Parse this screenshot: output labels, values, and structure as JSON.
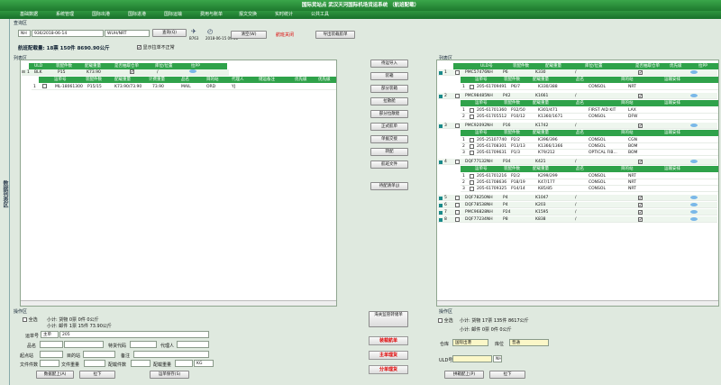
{
  "window": {
    "title": "国际货站点 武汉天河国际机场货运系统 （航班配载）"
  },
  "menu": [
    "基础数据",
    "系统管理",
    "国际出港",
    "国际进港",
    "国际运输",
    "费用与账单",
    "报文交换",
    "实时统计",
    "公共工具"
  ],
  "sidebar": {
    "label": "数据列表区"
  },
  "query": {
    "section_label": "查询区",
    "prefix": "NH",
    "flight_date": "936/2018-06-14",
    "route": "WUH/NRT",
    "query_btn": "查询(Q)",
    "plane_info": "B763",
    "time_info": "2018-06-15 09:40",
    "clear_btn": "清空(W)",
    "flight_status": "航班关闭",
    "export_btn": "导出装载航单",
    "summary": "航班配载量: 18票  150件  8690.90公斤",
    "show_unsigned_label": "显示拉单不正常"
  },
  "left_list": {
    "section_label": "列表区",
    "header": [
      "ULD",
      "装配件数",
      "配载重量",
      "是否抽取仓单",
      "库位/位置",
      "拉PP"
    ],
    "uld_row": {
      "idx": "1",
      "uld": "BLK",
      "pieces": "P15",
      "weight": "K73.90",
      "extracted": "✔",
      "location": "/"
    },
    "sub_header": [
      "运单号",
      "装配件数",
      "配载重量",
      "计费重量",
      "品名",
      "目的站",
      "代理人",
      "储运备注",
      "优先级",
      "优先级"
    ],
    "sub_row": {
      "idx": "1",
      "awb": "ML-18061300",
      "pieces": "P15/15",
      "weight": "K73.90/73.90",
      "charge": "73.90",
      "goods": "MAIL",
      "dest": "ORD",
      "agent": "YJ"
    }
  },
  "middle_buttons": [
    "待运导入",
    "装箱",
    "部分装箱",
    "拉散舱",
    "部分拉散舱",
    "正式航单",
    "单据交接",
    "转配",
    "航班文件",
    "待配清单(J)"
  ],
  "right_list": {
    "section_label": "列表区",
    "header": [
      "ULD号",
      "装配件数",
      "配载重量",
      "库位/位置",
      "是否抽取仓单",
      "优先级",
      "拉PP"
    ],
    "sub_header": [
      "运单号",
      "装配件数",
      "配载重量",
      "品名",
      "目的站",
      "运输安排"
    ],
    "groups": [
      {
        "idx": "1",
        "uld": "PMC57476NH",
        "pieces": "P6",
        "weight": "K330",
        "loc": "/",
        "extracted": "✔",
        "expanded": true,
        "subs": [
          {
            "idx": "1",
            "awb": "205-61709491",
            "pieces": "P6/7",
            "weight": "K330/388",
            "goods": "CONSOL",
            "dest": "NRT"
          }
        ]
      },
      {
        "idx": "2",
        "uld": "PMC98485NH",
        "pieces": "P42",
        "weight": "K1661",
        "loc": "/",
        "extracted": "✔",
        "expanded": true,
        "subs": [
          {
            "idx": "1",
            "awb": "205-61701360",
            "pieces": "P32/50",
            "weight": "K301/471",
            "goods": "FIRST AID KIT",
            "dest": "LAX"
          },
          {
            "idx": "2",
            "awb": "205-61705512",
            "pieces": "P10/12",
            "weight": "K1360/1671",
            "goods": "CONSOL",
            "dest": "DFW"
          }
        ]
      },
      {
        "idx": "3",
        "uld": "PMC92092NH",
        "pieces": "P16",
        "weight": "K1742",
        "loc": "/",
        "extracted": "✔",
        "expanded": true,
        "subs": [
          {
            "idx": "1",
            "awb": "205-25107740",
            "pieces": "P2/2",
            "weight": "K396/396",
            "goods": "CONSOL",
            "dest": "CGN"
          },
          {
            "idx": "2",
            "awb": "205-61708301",
            "pieces": "P13/13",
            "weight": "K1366/1366",
            "goods": "CONSOL",
            "dest": "BOM"
          },
          {
            "idx": "3",
            "awb": "205-61709631",
            "pieces": "P1/3",
            "weight": "K79/212",
            "goods": "OPTICAL FIB...",
            "dest": "BOM"
          }
        ]
      },
      {
        "idx": "4",
        "uld": "DQF77132NH",
        "pieces": "P34",
        "weight": "K421",
        "loc": "/",
        "extracted": "✔",
        "expanded": true,
        "subs": [
          {
            "idx": "1",
            "awb": "205-61701216",
            "pieces": "P2/2",
            "weight": "K299/299",
            "goods": "CONSOL",
            "dest": "NRT"
          },
          {
            "idx": "2",
            "awb": "205-61708636",
            "pieces": "P18/19",
            "weight": "K47/177",
            "goods": "CONSOL",
            "dest": "NRT"
          },
          {
            "idx": "3",
            "awb": "205-61709325",
            "pieces": "P14/14",
            "weight": "K85/85",
            "goods": "CONSOL",
            "dest": "NRT"
          }
        ]
      },
      {
        "idx": "5",
        "uld": "DQF78250NH",
        "pieces": "P4",
        "weight": "K1047",
        "loc": "/",
        "extracted": "✔",
        "expanded": false,
        "subs": []
      },
      {
        "idx": "6",
        "uld": "DQF78538NH",
        "pieces": "P4",
        "weight": "K203",
        "loc": "/",
        "extracted": "✔",
        "expanded": false,
        "subs": []
      },
      {
        "idx": "7",
        "uld": "PMC96828NH",
        "pieces": "P24",
        "weight": "K1595",
        "loc": "/",
        "extracted": "✔",
        "expanded": false,
        "subs": []
      },
      {
        "idx": "8",
        "uld": "DQF77234NH",
        "pieces": "P8",
        "weight": "K838",
        "loc": "/",
        "extracted": "✔",
        "expanded": false,
        "subs": []
      }
    ]
  },
  "left_op": {
    "section_label": "操作区",
    "select_all": "全选",
    "subtotal1": "小计: 货物  0票  0件  0公斤",
    "subtotal2": "小计: 邮件  1票  15件  73.90公斤",
    "awb_label": "运单号",
    "awb_prefix": "主单",
    "awb_value": "205",
    "goods_label": "品名",
    "special_label": "特货代码",
    "agent_label": "代理人",
    "origin_label": "起点站",
    "dest_label": "目的站",
    "remark_label": "备注",
    "files_label": "文件件数",
    "files_weight_label": "文件重量",
    "pieces_label": "配载件数",
    "weight_label": "配载重量",
    "unit": "KG",
    "btn_up": "数据配上(A)",
    "btn_down": "拉下",
    "btn_save": "运单保存(S)"
  },
  "center_op": {
    "print_btn": "海关监管转储单",
    "btn_load": "装载航单",
    "btn_main": "主单理货",
    "btn_split": "分单理货"
  },
  "right_op": {
    "section_label": "操作区",
    "select_all": "全选",
    "subtotal1": "小计: 货物  17票  135件  8617公斤",
    "subtotal2": "小计: 邮件  0票  0件  0公斤",
    "warehouse_label": "仓库",
    "warehouse_value": "国际出港",
    "area_label": "库位",
    "area_value": "普通",
    "uld_label": "ULD号",
    "uld_suffix": "NH",
    "btn_up": "拼箱配上(P)",
    "btn_down": "拉下"
  }
}
